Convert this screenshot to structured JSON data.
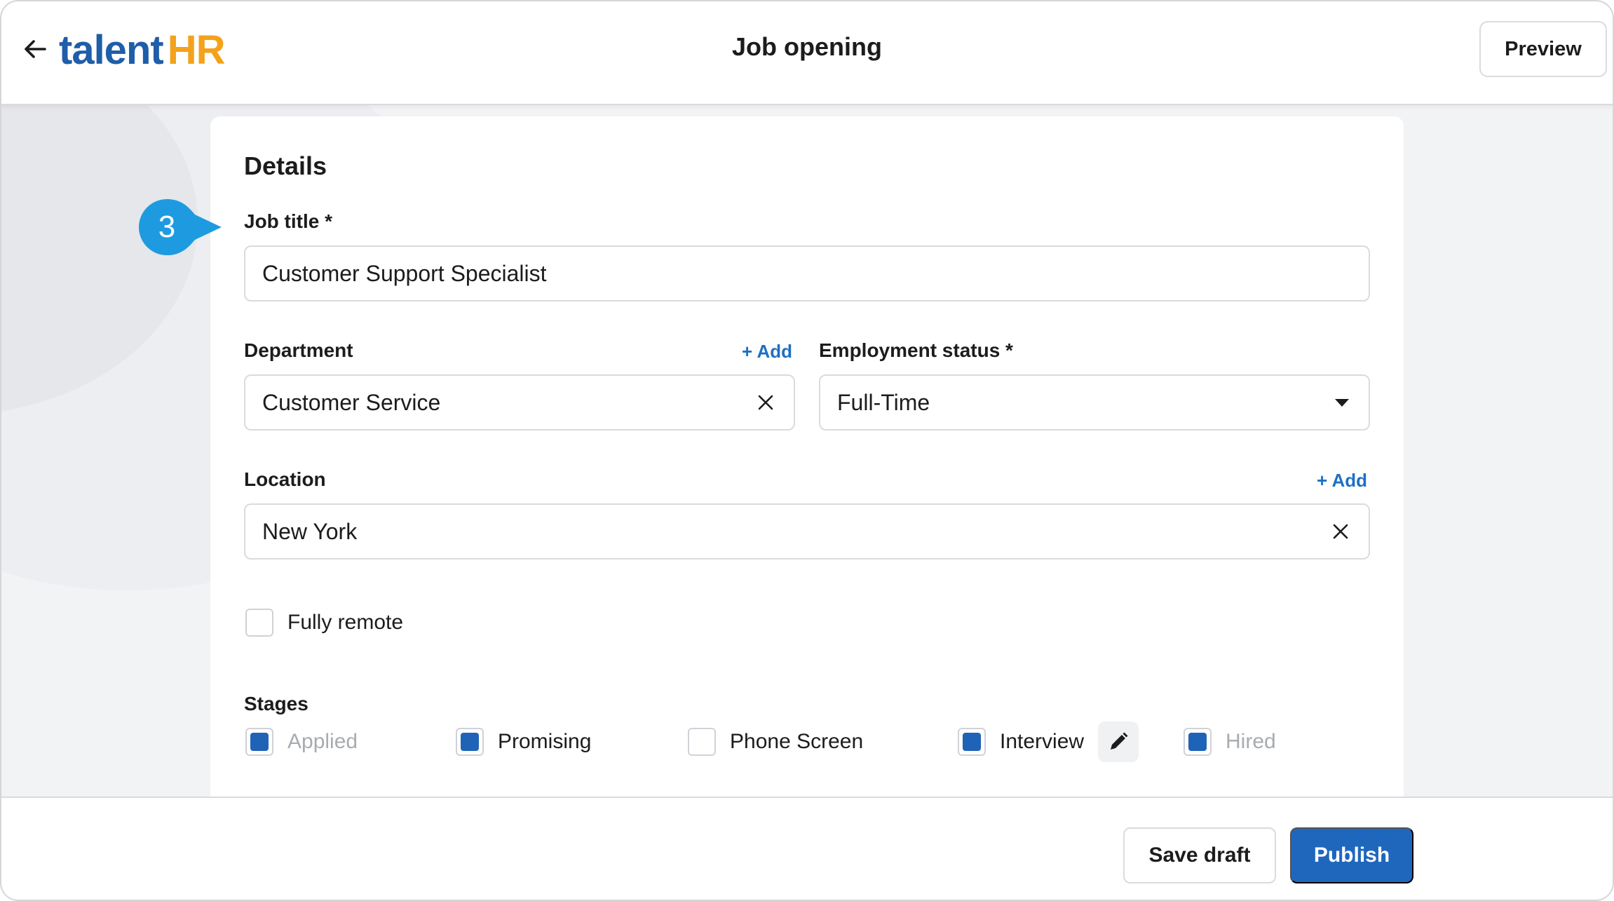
{
  "header": {
    "logo_primary": "talent",
    "logo_accent": "HR",
    "title": "Job opening",
    "preview_label": "Preview"
  },
  "step_marker": {
    "number": "3"
  },
  "details": {
    "section_title": "Details",
    "job_title_label": "Job title *",
    "job_title_value": "Customer Support Specialist",
    "department_label": "Department",
    "department_add": "+ Add",
    "department_value": "Customer Service",
    "employment_label": "Employment status *",
    "employment_value": "Full-Time",
    "location_label": "Location",
    "location_add": "+ Add",
    "location_value": "New York",
    "fully_remote_label": "Fully remote"
  },
  "stages": {
    "title": "Stages",
    "items": [
      {
        "label": "Applied",
        "checked": true,
        "muted": true
      },
      {
        "label": "Promising",
        "checked": true,
        "muted": false
      },
      {
        "label": "Phone Screen",
        "checked": false,
        "muted": false
      },
      {
        "label": "Interview",
        "checked": true,
        "muted": false
      },
      {
        "label": "Hired",
        "checked": true,
        "muted": true
      }
    ]
  },
  "footer": {
    "save_label": "Save draft",
    "publish_label": "Publish"
  },
  "colors": {
    "brand_blue": "#1f5ea8",
    "brand_orange": "#f3a21b",
    "primary_button": "#1f67bd",
    "step_marker": "#1e9be0"
  }
}
